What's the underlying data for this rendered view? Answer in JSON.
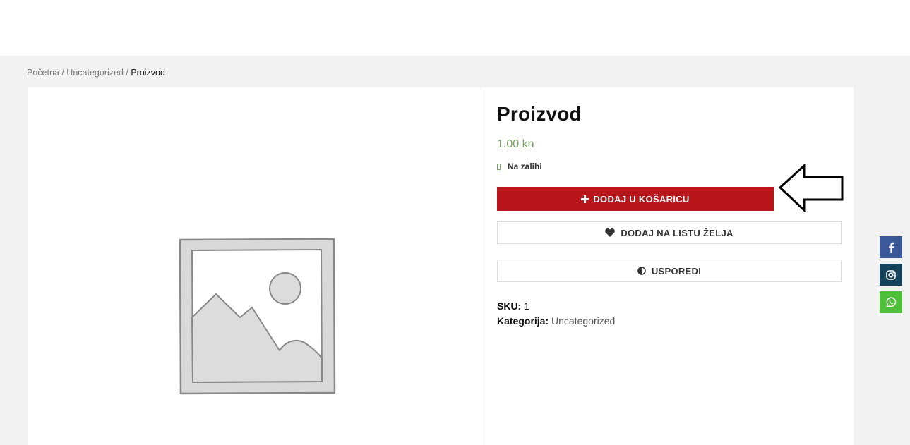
{
  "breadcrumb": {
    "home": "Početna",
    "category": "Uncategorized",
    "current": "Proizvod",
    "separator": " / "
  },
  "product": {
    "title": "Proizvod",
    "price": "1.00 kn",
    "stock": "Na zalihi",
    "add_to_cart": "DODAJ U KOŠARICU",
    "add_to_wishlist": "DODAJ NA LISTU ŽELJA",
    "compare": "USPOREDI",
    "sku_label": "SKU:",
    "sku_value": "1",
    "category_label": "Kategorija:",
    "category_value": "Uncategorized"
  },
  "icons": {
    "cart_plus": "plus-icon",
    "wishlist": "heart-icon",
    "compare": "half-circle-icon",
    "stock": "check-icon",
    "placeholder": "image-placeholder-icon",
    "annotation": "left-arrow-outline"
  },
  "social": [
    {
      "name": "facebook-icon",
      "color": "#3b5998"
    },
    {
      "name": "instagram-icon",
      "color": "#16435c"
    },
    {
      "name": "whatsapp-icon",
      "color": "#4fbf3a"
    }
  ],
  "colors": {
    "accent": "#b8161b",
    "price": "#77a464",
    "background": "#f2f2f2"
  }
}
